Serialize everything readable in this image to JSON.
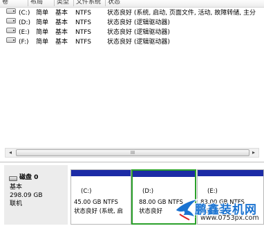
{
  "volume_list": {
    "headers": [
      "卷",
      "布局",
      "类型",
      "文件系统",
      "状态"
    ],
    "rows": [
      {
        "volume": "(C:)",
        "layout": "简单",
        "type": "基本",
        "fs": "NTFS",
        "status": "状态良好 (系统, 启动, 页面文件, 活动, 故障转储, 主分"
      },
      {
        "volume": "(D:)",
        "layout": "简单",
        "type": "基本",
        "fs": "NTFS",
        "status": "状态良好 (逻辑驱动器)"
      },
      {
        "volume": "(E:)",
        "layout": "简单",
        "type": "基本",
        "fs": "NTFS",
        "status": "状态良好 (逻辑驱动器)"
      },
      {
        "volume": "(F:)",
        "layout": "简单",
        "type": "基本",
        "fs": "NTFS",
        "status": "状态良好 (逻辑驱动器)"
      }
    ]
  },
  "scrollbar": {
    "left_arrow": "◂",
    "right_arrow": "▸",
    "thumb_grip": "III"
  },
  "disk": {
    "name": "磁盘 0",
    "type": "基本",
    "size": "298.09 GB",
    "status": "联机"
  },
  "partitions": [
    {
      "label": "(C:)",
      "size": "45.00 GB NTFS",
      "status": "状态良好 (系统, 启"
    },
    {
      "label": "(D:)",
      "size": "88.00 GB NTFS",
      "status": "状态良好"
    },
    {
      "label": "(E:)",
      "size": "83.00 GB NTFS",
      "status": "状态良好"
    }
  ],
  "watermark": {
    "title": "鹏鑫装机网",
    "url": "www.0753px.com"
  },
  "colors": {
    "partition_bar": "#1c2ba6",
    "selected_border": "#2aa02a",
    "watermark": "#1a73d1"
  }
}
